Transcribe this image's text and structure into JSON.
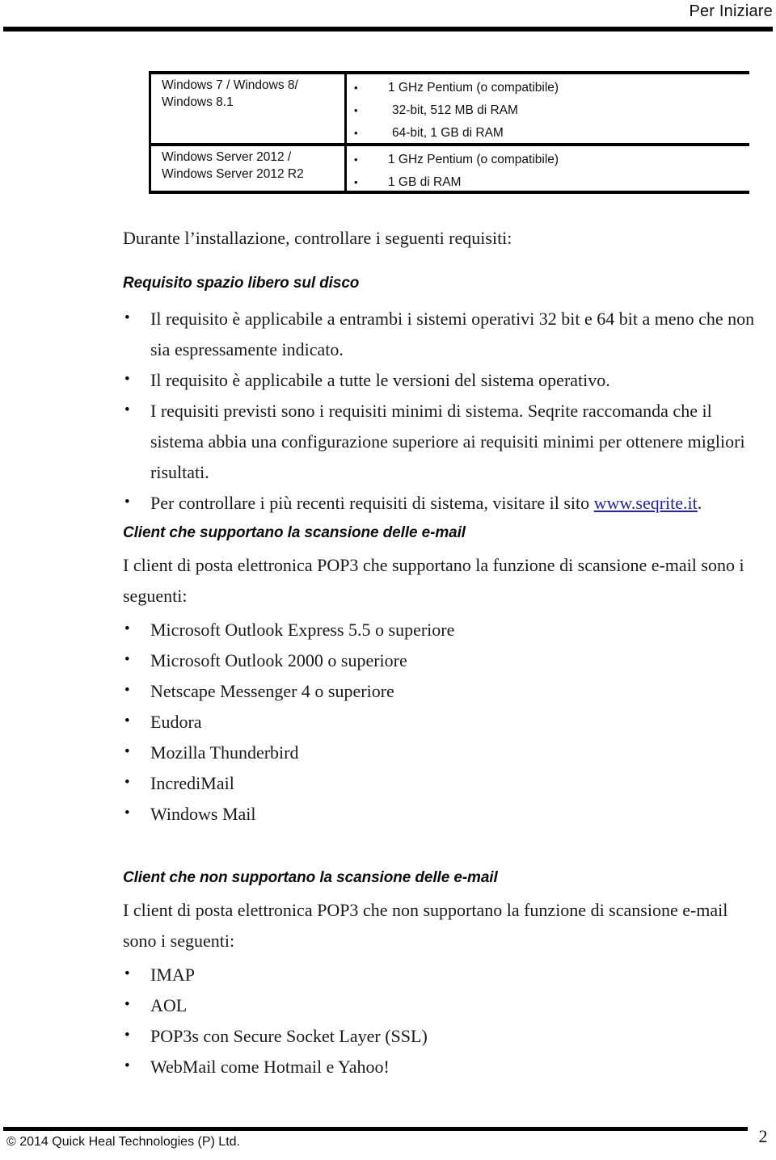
{
  "header": {
    "title": "Per Iniziare"
  },
  "table": {
    "rows": [
      {
        "os": "Windows 7 / Windows 8/ Windows 8.1",
        "specs": [
          "1 GHz Pentium (o compatibile)",
          "32-bit, 512 MB di RAM",
          "64-bit, 1 GB di RAM"
        ]
      },
      {
        "os": "Windows Server 2012 / Windows Server 2012 R2",
        "specs": [
          "1 GHz Pentium (o compatibile)",
          "1 GB di RAM"
        ]
      }
    ]
  },
  "body": {
    "intro_paragraph": "Durante l’installazione, controllare i seguenti requisiti:",
    "disk_section": {
      "heading": "Requisito spazio libero sul disco",
      "bullets": [
        "Il requisito è applicabile a entrambi i sistemi operativi 32 bit e 64 bit a meno che non sia espressamente indicato.",
        "Il  requisito è applicabile a tutte le versioni del sistema operativo.",
        "I requisiti previsti sono i requisiti minimi di sistema. Seqrite raccomanda che il sistema abbia una configurazione superiore ai requisiti minimi per ottenere migliori risultati."
      ],
      "link_bullet": {
        "before": "Per controllare i più recenti requisiti di sistema, visitare il sito ",
        "link_text": "www.seqrite.it",
        "after": "."
      }
    },
    "supported_section": {
      "heading": "Client che supportano la scansione delle e-mail",
      "paragraph": "I client di posta elettronica POP3 che supportano la funzione di scansione e-mail sono i seguenti:",
      "items": [
        "Microsoft Outlook Express 5.5 o superiore",
        "Microsoft Outlook 2000 o superiore",
        "Netscape Messenger 4 o superiore",
        "Eudora",
        "Mozilla Thunderbird",
        "IncrediMail",
        "Windows Mail"
      ]
    },
    "unsupported_section": {
      "heading": "Client che non supportano la scansione delle e-mail",
      "paragraph": "I client di posta elettronica POP3 che non supportano la funzione di scansione e-mail sono i seguenti:",
      "items": [
        "IMAP",
        "AOL",
        "POP3s con Secure Socket Layer (SSL)",
        "WebMail come Hotmail e Yahoo!"
      ]
    }
  },
  "footer": {
    "copyright": "© 2014 Quick Heal Technologies (P) Ltd.",
    "page_number": "2"
  },
  "colors": {
    "text": "#1a1a1a",
    "link": "#23239c",
    "rule": "#000000"
  }
}
